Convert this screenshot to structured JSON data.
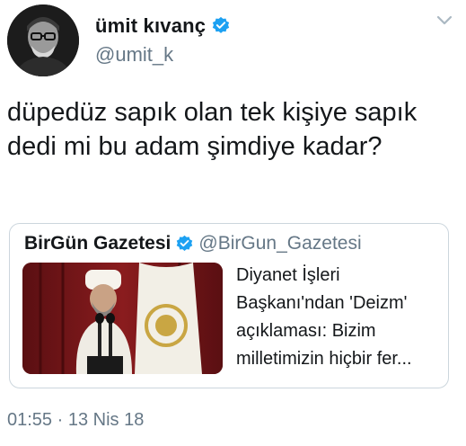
{
  "tweet": {
    "author": {
      "name": "ümit kıvanç",
      "handle": "@umit_k",
      "verified": true
    },
    "text": "düpedüz sapık olan tek kişiye sapık dedi mi bu adam şimdiye kadar?",
    "timestamp": "01:55 · 13 Nis 18",
    "icons": {
      "verified": "verified-badge-icon",
      "menu": "chevron-down-icon"
    }
  },
  "quote": {
    "author": {
      "name": "BirGün Gazetesi",
      "handle": "@BirGun_Gazetesi",
      "verified": true
    },
    "text": "Diyanet İşleri Başkanı'ndan 'Deizm' açıklaması: Bizim milletimizin hiçbir fer..."
  },
  "colors": {
    "text": "#14171a",
    "secondary": "#657786",
    "verified_blue": "#1da1f2",
    "border": "#ccd6dd"
  }
}
